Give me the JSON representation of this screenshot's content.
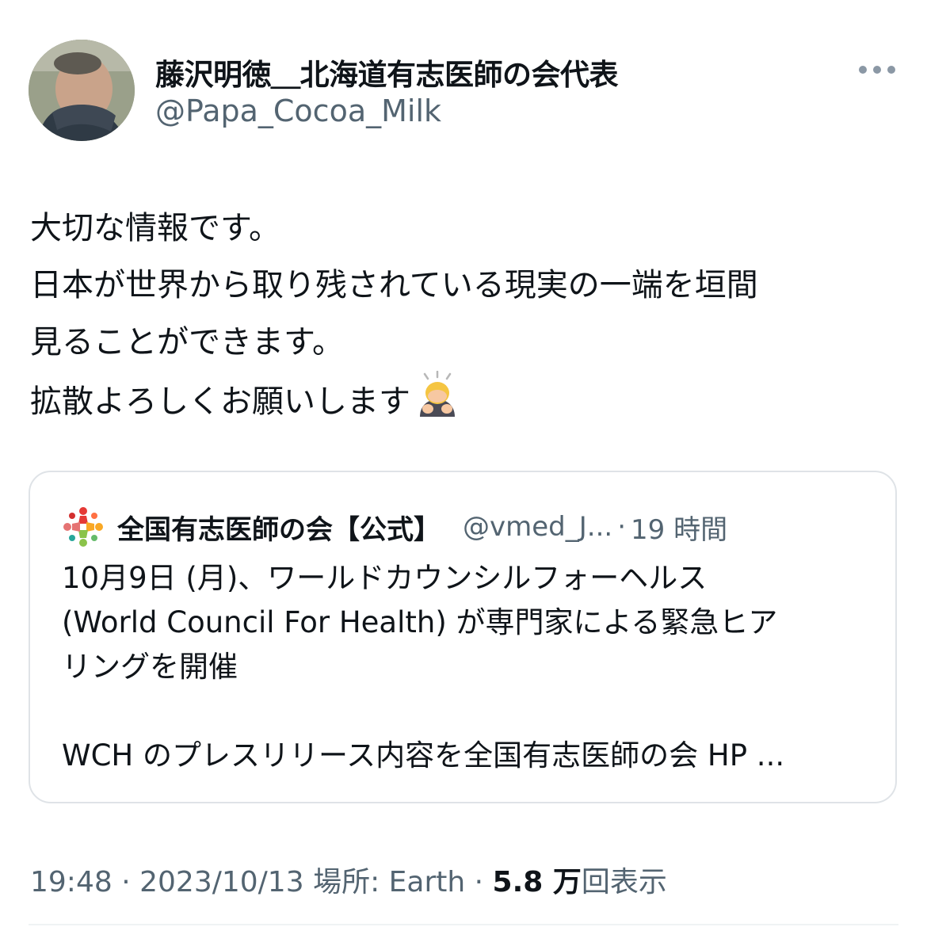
{
  "author": {
    "name": "藤沢明徳＿北海道有志医師の会代表",
    "handle": "@Papa_Cocoa_Milk"
  },
  "menu": {
    "more_icon": "more-horizontal-icon"
  },
  "tweet": {
    "lines": [
      "大切な情報です。",
      "日本が世界から取り残されている現実の一端を垣間",
      "見ることができます。",
      "拡散よろしくお願いします"
    ],
    "emoji": "person-bowing-emoji"
  },
  "quote": {
    "logo_icon": "organization-logo-icon",
    "name": "全国有志医師の会【公式】",
    "handle": "@vmed_J...",
    "separator": "·",
    "time": "19 時間",
    "lines": [
      "10月9日 (月)、ワールドカウンシルフォーヘルス",
      "(World Council For Health) が専門家による緊急ヒア",
      "リングを開催"
    ],
    "line_last": "WCH のプレスリリース内容を全国有志医師の会 HP ..."
  },
  "meta": {
    "time": "19:48",
    "sep1": "·",
    "date": "2023/10/13",
    "location": "場所: Earth",
    "sep2": "·",
    "views_count": "5.8 万",
    "views_label": "回表示"
  }
}
